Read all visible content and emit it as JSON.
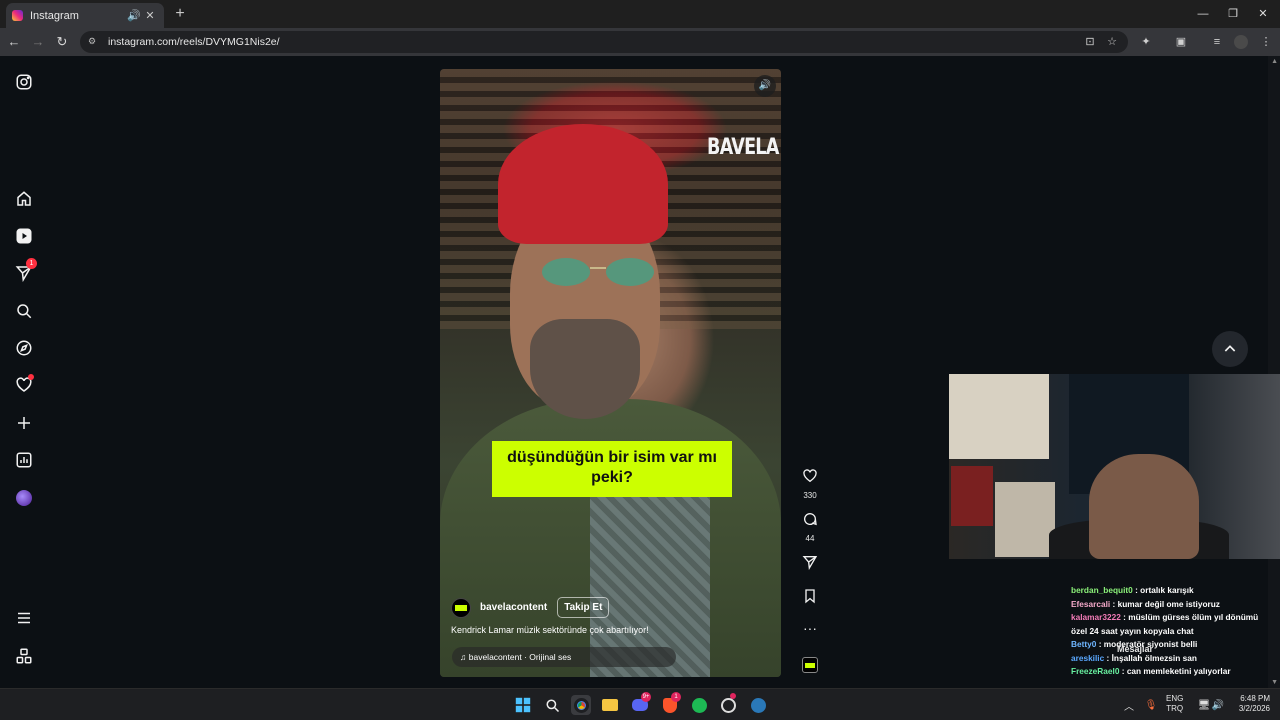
{
  "browser": {
    "tab_title": "Instagram",
    "url": "instagram.com/reels/DVYMG1Nis2e/"
  },
  "sidebar": {
    "items": [
      {
        "name": "instagram-logo"
      },
      {
        "name": "home"
      },
      {
        "name": "reels"
      },
      {
        "name": "messages",
        "badge": "1"
      },
      {
        "name": "search"
      },
      {
        "name": "explore"
      },
      {
        "name": "notifications"
      },
      {
        "name": "create"
      },
      {
        "name": "dashboard"
      },
      {
        "name": "profile"
      },
      {
        "name": "more"
      },
      {
        "name": "also-from-meta"
      }
    ]
  },
  "reel": {
    "watermark": "BAVELA",
    "subtitle_line1": "düşündüğün bir isim var mı",
    "subtitle_line2": "peki?",
    "author": "bavelacontent",
    "follow_label": "Takip Et",
    "caption": "Kendrick Lamar müzik sektöründe çok abartılıyor!",
    "audio": "bavelacontent · Orijinal ses",
    "likes": "330",
    "comments": "44"
  },
  "chat": {
    "messages": [
      {
        "user": "berdan_bequit0",
        "text": ": ortalık karışık",
        "color": "#8cf27a"
      },
      {
        "user": "Efesarcali",
        "text": ": kumar değil ome istiyoruz",
        "color": "#f4a9c9"
      },
      {
        "user": "kalamar3222",
        "text": ": müslüm gürses ölüm yıl dönümü özel 24 saat yayın kopyala chat",
        "color": "#f47cb8"
      },
      {
        "user": "Betty0",
        "text": ": moderatör siyonist belli",
        "color": "#6fb6ff"
      },
      {
        "user": "areskilic",
        "text": ": İnşallah ölmezsin san",
        "color": "#5aa8ff"
      },
      {
        "user": "FreezeRael0",
        "text": ": can memleketini yalıyorlar",
        "color": "#68f0a0"
      }
    ],
    "overlay_label": "Mesajlar"
  },
  "taskbar": {
    "lang_line1": "ENG",
    "lang_line2": "TRQ",
    "time": "6:48 PM",
    "date": "3/2/2026",
    "discord_badge": "9+",
    "brave_badge": "1"
  },
  "colors": {
    "subtitle_bg": "#ccff00",
    "notification_red": "#ff3040"
  }
}
